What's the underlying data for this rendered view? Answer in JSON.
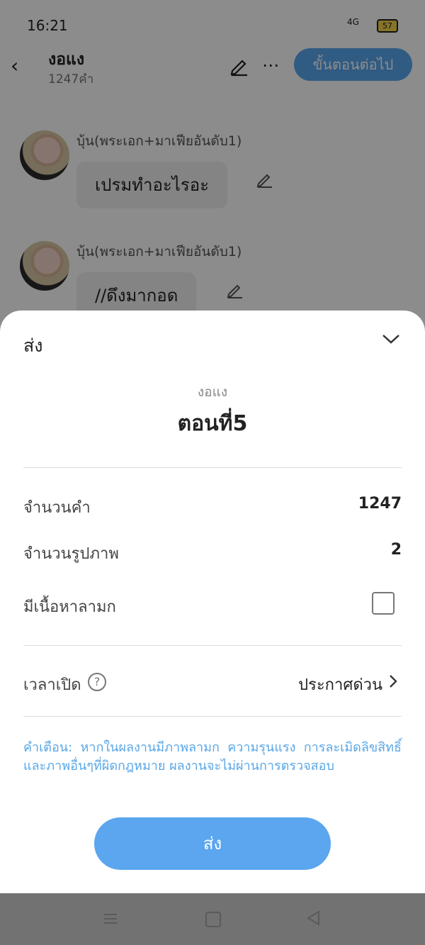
{
  "status_bar": {
    "time": "16:21",
    "signal": "4G",
    "battery": "57"
  },
  "header": {
    "title": "งอแง",
    "word_count": "1247คำ",
    "next_button": "ขั้นตอนต่อไป"
  },
  "messages": [
    {
      "speaker": "บุ้น(พระเอก+มาเฟียอันดับ1)",
      "text": "เปรมทำอะไรอะ"
    },
    {
      "speaker": "บุ้น(พระเอก+มาเฟียอันดับ1)",
      "text": "//ดึงมากอด"
    }
  ],
  "sheet": {
    "title": "ส่ง",
    "story_name": "งอแง",
    "chapter": "ตอนที่5",
    "rows": [
      {
        "label": "จำนวนคำ",
        "value": "1247"
      },
      {
        "label": "จำนวนรูปภาพ",
        "value": "2"
      },
      {
        "label": "มีเนื้อหาลามก",
        "value": ""
      }
    ],
    "open_time_label": "เวลาเปิด",
    "help_glyph": "?",
    "open_time_value": "ประกาศด่วน",
    "warning": "คำเตือน: หากในผลงานมีภาพลามก ความรุนแรง การละเมิดลิขสิทธิ์และภาพอื่นๆที่ผิดกฎหมาย ผลงานจะไม่ผ่านการตรวจสอบ",
    "send_button": "ส่ง"
  },
  "colors": {
    "accent": "#5ba6ee",
    "warning_text": "#5aa7e6",
    "overlay": "rgba(0,0,0,0.45)"
  },
  "icons": [
    "back-icon",
    "pen-icon",
    "more-icon",
    "chevron-down-icon",
    "help-icon",
    "chevron-right-icon",
    "menu-icon",
    "home-icon",
    "nav-back-icon"
  ]
}
